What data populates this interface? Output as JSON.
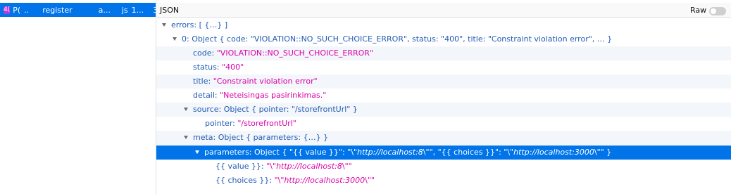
{
  "left_panel": {
    "request": {
      "status": "4(",
      "method": "P(",
      "dots": "..",
      "file": "register",
      "domain": "a...",
      "type": "js",
      "size": "1...",
      "tail": "3"
    }
  },
  "panel": {
    "title": "JSON",
    "raw_label": "Raw"
  },
  "tree": {
    "errors_key": "errors:",
    "errors_preview": "[ {…} ]",
    "item0_key": "0:",
    "item0_preview": "Object { code: \"VIOLATION::NO_SUCH_CHOICE_ERROR\", status: \"400\", title: \"Constraint violation error\", … }",
    "code_key": "code:",
    "code_val": "\"VIOLATION::NO_SUCH_CHOICE_ERROR\"",
    "status_key": "status:",
    "status_val": "\"400\"",
    "title_key": "title:",
    "title_val": "\"Constraint violation error\"",
    "detail_key": "detail:",
    "detail_val": "\"Neteisingas pasirinkimas.\"",
    "source_key": "source:",
    "source_preview": "Object { pointer: \"/storefrontUrl\" }",
    "pointer_key": "pointer:",
    "pointer_val": "\"/storefrontUrl\"",
    "meta_key": "meta:",
    "meta_preview": "Object { parameters: {…} }",
    "parameters_key": "parameters:",
    "parameters_preview_a": "Object { \"{{ value }}\": \"\\\"",
    "parameters_preview_b": "http://localhost:8",
    "parameters_preview_c": "\\\"\", \"{{ choices }}\": \"\\\"",
    "parameters_preview_d": "http://localhost:3000",
    "parameters_preview_e": "\\\"\" }",
    "value_key": "{{ value }}:",
    "value_a": "\"\\\"",
    "value_b": "http://localhost:8",
    "value_c": "\\\"\"",
    "choices_key": "{{ choices }}:",
    "choices_a": "\"\\\"",
    "choices_b": "http://localhost:3000",
    "choices_c": "\\\"\""
  }
}
